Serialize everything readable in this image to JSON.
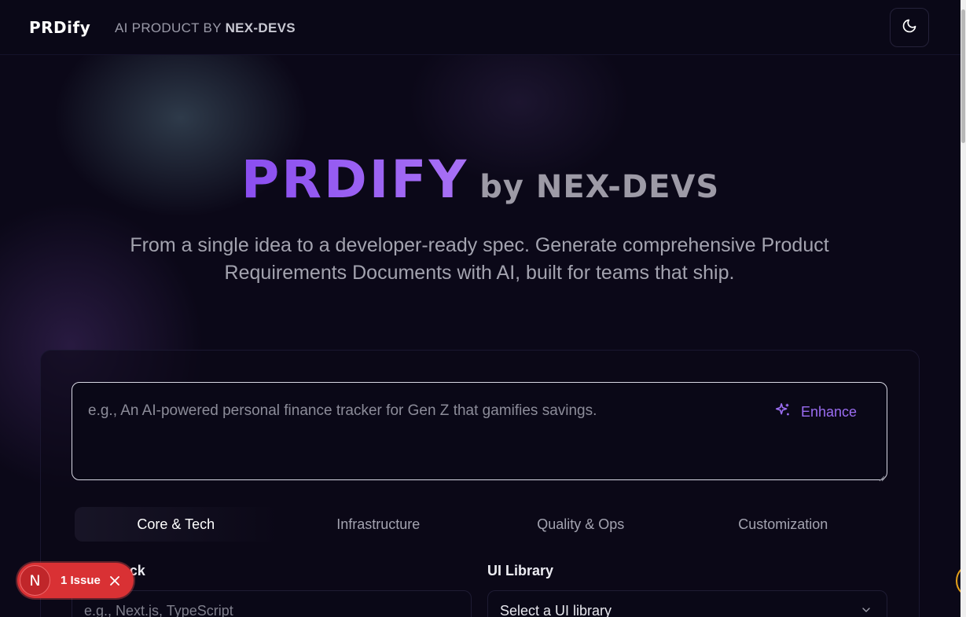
{
  "header": {
    "logo": "PRDify",
    "tagline_prefix": "AI PRODUCT BY",
    "tagline_brand": "NEX-DEVS",
    "theme_toggle_icon": "moon-icon"
  },
  "hero": {
    "brand": "PRDIFY",
    "by_line": "by NEX-DEVS",
    "subtitle": "From a single idea to a developer-ready spec. Generate comprehensive Product Requirements Documents with AI, built for teams that ship."
  },
  "idea_input": {
    "placeholder": "e.g., An AI-powered personal finance tracker for Gen Z that gamifies savings.",
    "value": "",
    "enhance_label": "Enhance",
    "enhance_icon": "sparkles-icon"
  },
  "tabs": [
    {
      "label": "Core & Tech",
      "active": true
    },
    {
      "label": "Infrastructure",
      "active": false
    },
    {
      "label": "Quality & Ops",
      "active": false
    },
    {
      "label": "Customization",
      "active": false
    }
  ],
  "fields": {
    "tech_stack": {
      "label": "Tech Stack",
      "placeholder": "e.g., Next.js, TypeScript"
    },
    "ui_library": {
      "label": "UI Library",
      "value": "Select a UI library"
    }
  },
  "dev_overlay": {
    "badge_letter": "N",
    "issue_label": "1 Issue"
  },
  "colors": {
    "background": "#0b0818",
    "accent": "#9b6df2",
    "issue_red": "#d93134"
  }
}
